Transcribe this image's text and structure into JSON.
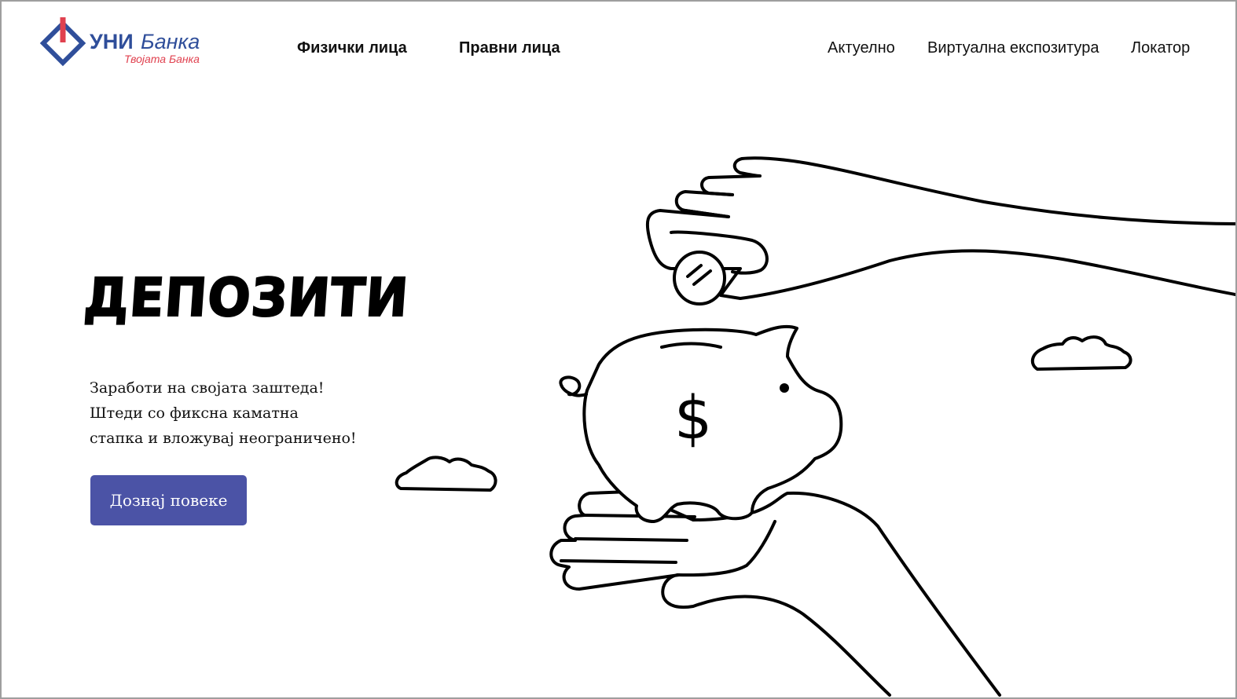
{
  "header": {
    "logo": {
      "brand_part1": "УНИ",
      "brand_part2": "Банка",
      "tagline": "Твојата Банка",
      "primary_color": "#2f4e9a",
      "accent_color": "#e0414f"
    },
    "nav_left": [
      {
        "label": "Физички лица"
      },
      {
        "label": "Правни лица"
      }
    ],
    "nav_right": [
      {
        "label": "Актуелно"
      },
      {
        "label": "Виртуална експозитура"
      },
      {
        "label": "Локатор"
      }
    ]
  },
  "hero": {
    "title": "ДЕПОЗИТИ",
    "description_lines": [
      "Заработи на својата заштеда!",
      "Штеди со фиксна каматна",
      "стапка и вложувај неограничено!"
    ],
    "cta_label": "Дознај повеке",
    "cta_color": "#4b53a6",
    "illustration": {
      "icon": "piggy-bank-with-hands-icon",
      "symbol": "$"
    }
  }
}
